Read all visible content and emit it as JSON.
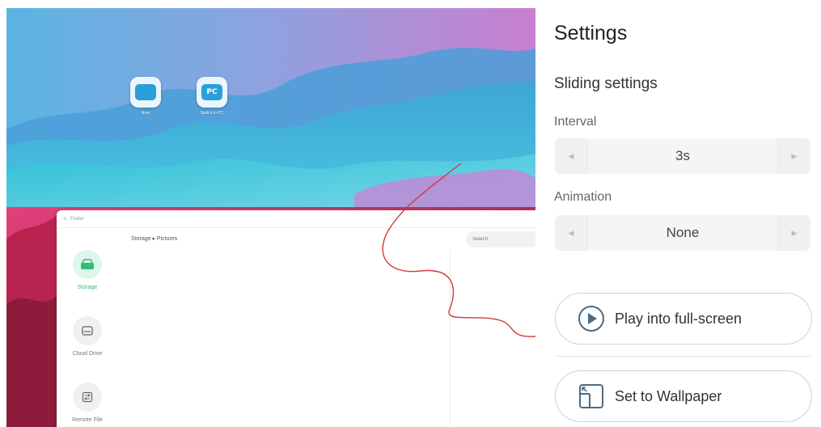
{
  "desktop": {
    "icons": [
      {
        "name": "Note",
        "badge": ""
      },
      {
        "name": "Switch to PC",
        "badge": "PC"
      }
    ]
  },
  "finder": {
    "title": "Finder",
    "breadcrumb": "Storage ▸ Pictures",
    "search_placeholder": "Search",
    "sidebar": [
      {
        "label": "Storage",
        "icon": "storage-icon",
        "active": true
      },
      {
        "label": "Cloud Drive",
        "icon": "cloud-drive-icon",
        "active": false
      },
      {
        "label": "Remote File",
        "icon": "remote-file-icon",
        "active": false
      }
    ]
  },
  "settings": {
    "title": "Settings",
    "section_title": "Sliding settings",
    "interval": {
      "label": "Interval",
      "value": "3s"
    },
    "animation": {
      "label": "Animation",
      "value": "None"
    },
    "play_button": "Play into full-screen",
    "wallpaper_button": "Set to Wallpaper"
  },
  "colors": {
    "accent_green": "#2fbf73",
    "annotation_red": "#d23a3a",
    "panel_border": "#cfd3d6"
  }
}
